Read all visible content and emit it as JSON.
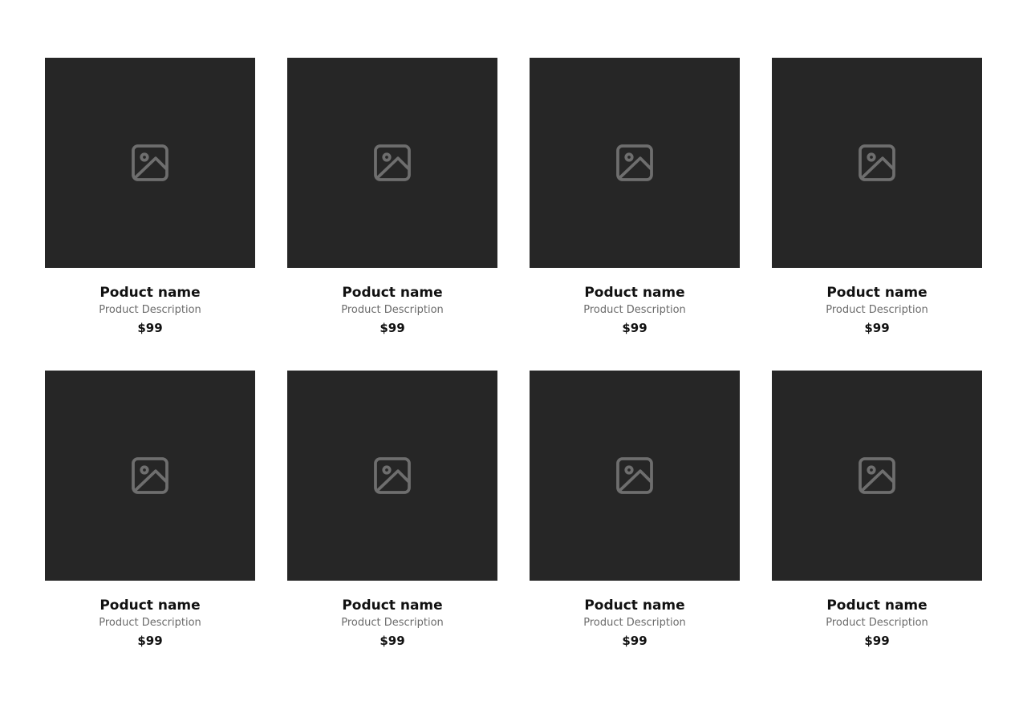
{
  "products": [
    {
      "name": "Poduct name",
      "description": "Product Description",
      "price": "$99",
      "icon": "image-placeholder-icon"
    },
    {
      "name": "Poduct name",
      "description": "Product Description",
      "price": "$99",
      "icon": "image-placeholder-icon"
    },
    {
      "name": "Poduct name",
      "description": "Product Description",
      "price": "$99",
      "icon": "image-placeholder-icon"
    },
    {
      "name": "Poduct name",
      "description": "Product Description",
      "price": "$99",
      "icon": "image-placeholder-icon"
    },
    {
      "name": "Poduct name",
      "description": "Product Description",
      "price": "$99",
      "icon": "image-placeholder-icon"
    },
    {
      "name": "Poduct name",
      "description": "Product Description",
      "price": "$99",
      "icon": "image-placeholder-icon"
    },
    {
      "name": "Poduct name",
      "description": "Product Description",
      "price": "$99",
      "icon": "image-placeholder-icon"
    },
    {
      "name": "Poduct name",
      "description": "Product Description",
      "price": "$99",
      "icon": "image-placeholder-icon"
    }
  ],
  "colors": {
    "thumbnail_bg": "#262626",
    "icon": "#6e6e6e",
    "text_primary": "#111111",
    "text_secondary": "#6b6b6b"
  }
}
